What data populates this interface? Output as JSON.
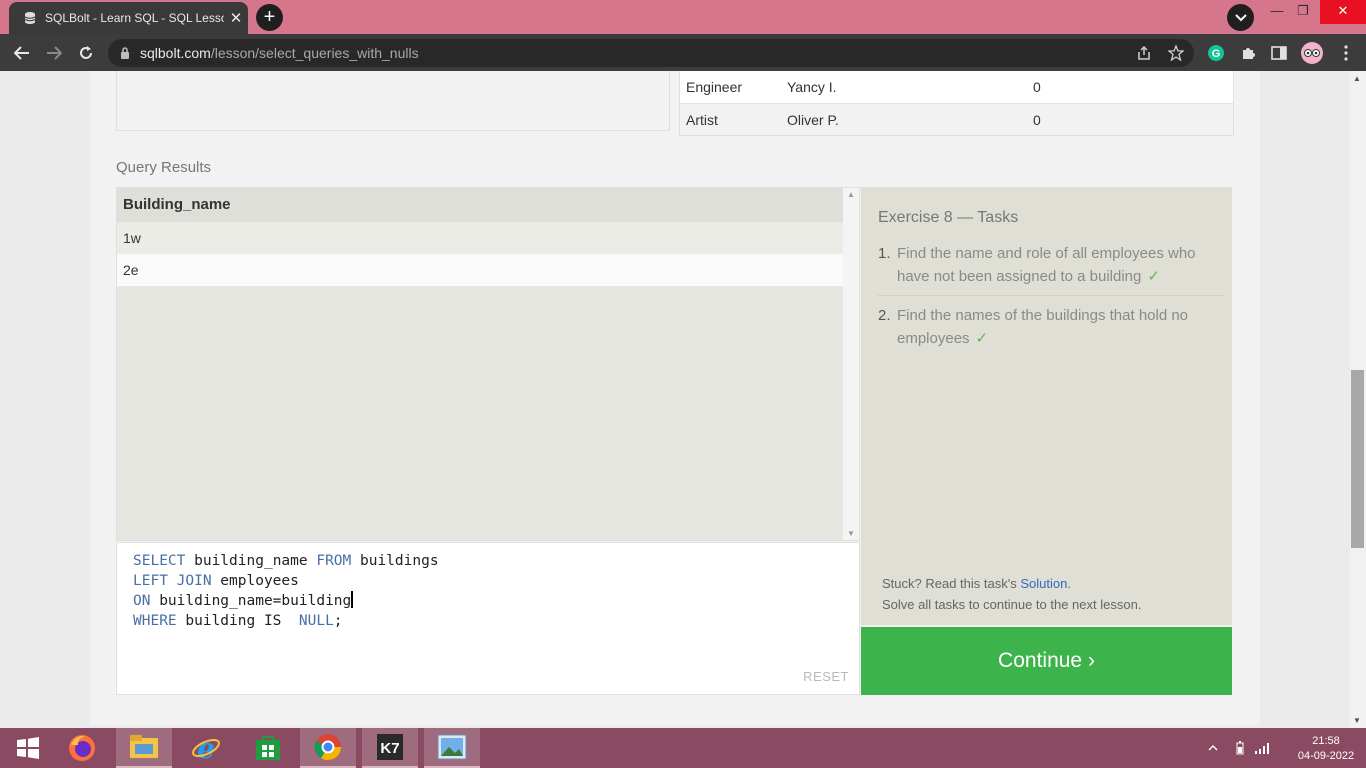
{
  "browser": {
    "tab_title": "SQLBolt - Learn SQL - SQL Lesson",
    "url_host": "sqlbolt.com",
    "url_path": "/lesson/select_queries_with_nulls",
    "new_tab": "+",
    "close_tab": "✕",
    "minimize": "—",
    "restore": "❐",
    "close_window": "✕"
  },
  "table": {
    "rows": [
      {
        "role": "Engineer",
        "name": "Yancy I.",
        "years": "0"
      },
      {
        "role": "Artist",
        "name": "Oliver P.",
        "years": "0"
      }
    ]
  },
  "query_results": {
    "label": "Query Results",
    "header": "Building_name",
    "rows": [
      "1w",
      "2e"
    ]
  },
  "editor": {
    "line1_kw": "SELECT",
    "line1_rest": " building_name ",
    "line1_kw2": "FROM",
    "line1_rest2": " buildings",
    "line2_kw": "LEFT JOIN",
    "line2_rest": " employees",
    "line3_kw": "ON",
    "line3_rest": " building_name=building",
    "line4_kw": "WHERE",
    "line4_rest": " building IS  ",
    "line4_kw2": "NULL",
    "line4_end": ";",
    "reset_label": "RESET"
  },
  "tasks": {
    "title": "Exercise 8 — Tasks",
    "items": [
      {
        "num": "1.",
        "text": "Find the name and role of all employees who have not been assigned to a building",
        "check": "✓"
      },
      {
        "num": "2.",
        "text": "Find the names of the buildings that hold no employees",
        "check": "✓"
      }
    ],
    "stuck_prefix": "Stuck? Read this task's ",
    "stuck_link": "Solution",
    "stuck_suffix": ".",
    "stuck_line2": "Solve all tasks to continue to the next lesson."
  },
  "continue_label": "Continue ›",
  "taskbar": {
    "time": "21:58",
    "date": "04-09-2022",
    "k7_label": "K7"
  },
  "colors": {
    "tab_bar": "#d6768d",
    "continue_button": "#3cb44b",
    "keyword": "#4a6fa5",
    "taskbar": "#8a4b62"
  }
}
